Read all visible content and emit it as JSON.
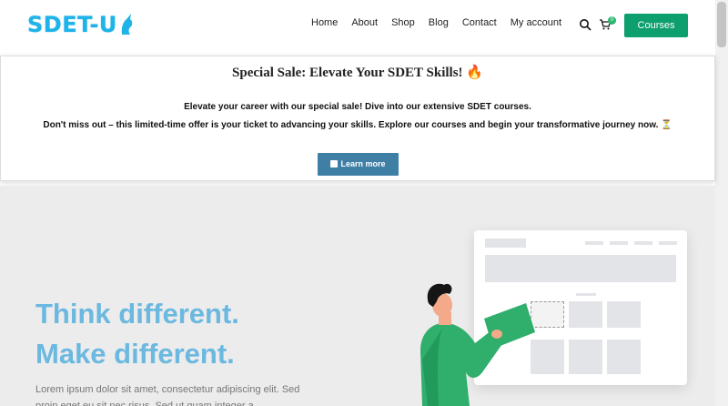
{
  "header": {
    "logo_text": "SDET-U",
    "nav": [
      "Home",
      "About",
      "Shop",
      "Blog",
      "Contact",
      "My account"
    ],
    "cart_count": "0",
    "courses_label": "Courses"
  },
  "banner": {
    "title": "Special Sale: Elevate Your SDET Skills! 🔥",
    "line1": "Elevate your career with our special sale! Dive into our extensive SDET courses.",
    "line2": "Don't miss out – this limited-time offer is your ticket to advancing your skills. Explore our courses and begin your transformative journey now. ⏳",
    "button_label": "Learn more"
  },
  "hero": {
    "title_line1": "Think different.",
    "title_line2": "Make different.",
    "text": "Lorem ipsum dolor sit amet, consectetur adipiscing elit. Sed proin eget eu sit nec risus. Sed ut quam integer a"
  },
  "colors": {
    "brand": "#1fb3e8",
    "accent": "#0e9f6e",
    "button_blue": "#3f7fa5",
    "hero_title": "#6bb8e0"
  }
}
